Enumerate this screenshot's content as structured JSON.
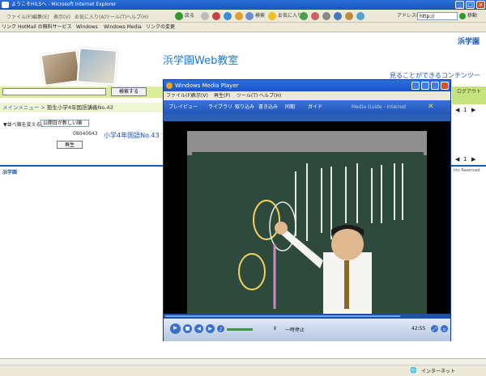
{
  "browser": {
    "title": "ようこそHILSへ - Microsoft Internet Explorer",
    "menu": [
      "ファイル(F)",
      "編集(E)",
      "表示(V)",
      "お気に入り(A)",
      "ツール(T)",
      "ヘルプ(H)"
    ],
    "toolbar": {
      "back": "戻る",
      "search": "検索",
      "favorites": "お気に入り"
    },
    "address_label": "アドレス(D)",
    "address_value": "http://",
    "go_label": "移動",
    "links_label": "リンク",
    "links": [
      "HotMail の無料サービス",
      "Windows",
      "Windows Media",
      "リンクの変更"
    ],
    "status_zone": "インターネット"
  },
  "page": {
    "logo_text": "浜学園",
    "site_title": "浜学園Web教室",
    "contents_link": "見ることができるコンテンツ一覧",
    "search_button": "検索する",
    "breadcrumb_prefix": "メインメニュー > ",
    "breadcrumb_current": "塾生小学4年国語講義No.43",
    "order_label": "▼並べ順を変える:",
    "order_value": "公開日が新しい順",
    "code": "08040643",
    "lesson_link": "小学4年国語No.43",
    "play_button": "再生",
    "footer_logo": "浜学園",
    "right_strip": "ログアウト",
    "page_num": "1",
    "reserved": "hts Reserved"
  },
  "wmp": {
    "title": "Windows Media Player",
    "menu": [
      "ファイル(F)",
      "表示(V)",
      "再生(P)",
      "ツール(T)",
      "ヘルプ(H)"
    ],
    "tabs": [
      "プレイビュー",
      "ライブラリ",
      "取り込み",
      "書き込み",
      "同期",
      "ガイド"
    ],
    "tabs_hint": "Media Guide - Internet",
    "status": "一時停止",
    "time": "42:55"
  },
  "colors": {
    "accent": "#1e7acb",
    "ie_blue": "#2a6fd6",
    "green": "#d9ed9a"
  }
}
